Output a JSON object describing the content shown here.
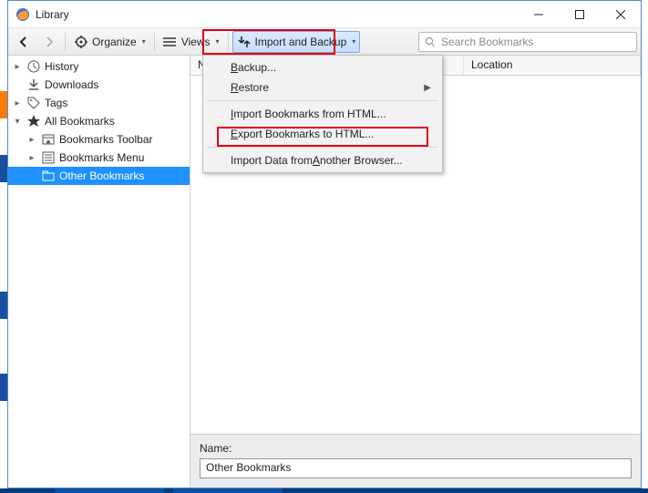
{
  "window": {
    "title": "Library"
  },
  "toolbar": {
    "organize": "Organize",
    "views": "Views",
    "import_backup": "Import and Backup"
  },
  "search": {
    "placeholder": "Search Bookmarks"
  },
  "columns": {
    "name": "Name",
    "location": "Location"
  },
  "tree": {
    "history": "History",
    "downloads": "Downloads",
    "tags": "Tags",
    "all_bookmarks": "All Bookmarks",
    "bookmarks_toolbar": "Bookmarks Toolbar",
    "bookmarks_menu": "Bookmarks Menu",
    "other_bookmarks": "Other Bookmarks"
  },
  "dropdown": {
    "backup_pre": "",
    "backup_u": "B",
    "backup_post": "ackup...",
    "restore_pre": "",
    "restore_u": "R",
    "restore_post": "estore",
    "import_html_pre": "",
    "import_html_u": "I",
    "import_html_post": "mport Bookmarks from HTML...",
    "export_html_pre": "",
    "export_html_u": "E",
    "export_html_post": "xport Bookmarks to HTML...",
    "import_browser_pre": "Import Data from ",
    "import_browser_u": "A",
    "import_browser_post": "nother Browser..."
  },
  "details": {
    "name_label": "Name:",
    "name_value": "Other Bookmarks"
  }
}
